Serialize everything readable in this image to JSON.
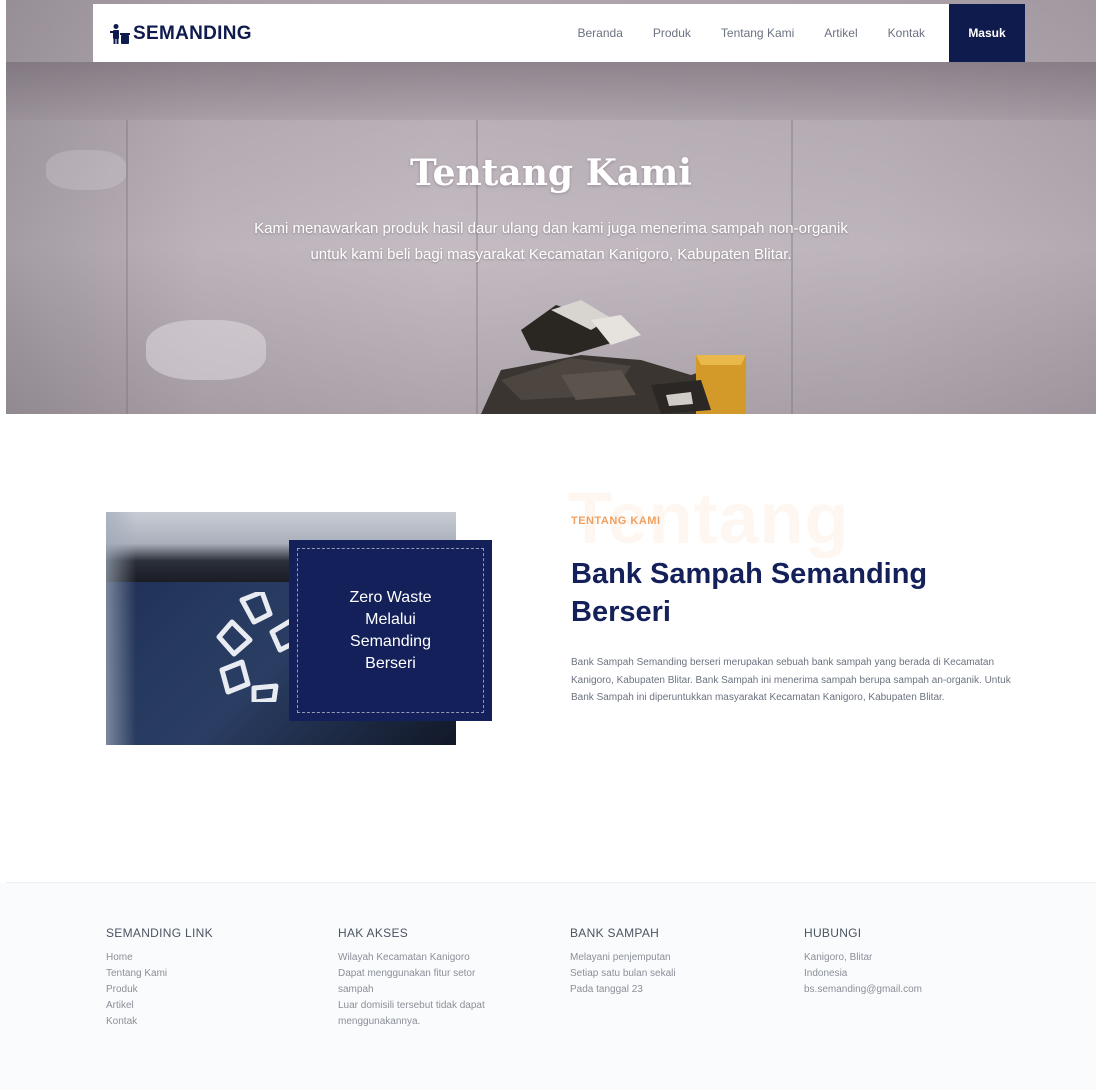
{
  "brand": {
    "name": "SEMANDING"
  },
  "nav": {
    "items": [
      "Beranda",
      "Produk",
      "Tentang Kami",
      "Artikel",
      "Kontak"
    ],
    "login_label": "Masuk"
  },
  "hero": {
    "title": "Tentang Kami",
    "subtitle_line1": "Kami menawarkan produk hasil daur ulang dan kami juga menerima sampah non-organik",
    "subtitle_line2": "untuk kami beli bagi masyarakat Kecamatan Kanigoro, Kabupaten Blitar."
  },
  "about": {
    "card_text": "Zero Waste Melalui Semanding Berseri",
    "ghost_word": "Tentang",
    "eyebrow": "TENTANG KAMI",
    "title": "Bank Sampah Semanding Berseri",
    "body": "Bank Sampah Semanding berseri merupakan sebuah bank sampah yang berada di Kecamatan Kanigoro, Kabupaten Blitar. Bank Sampah ini menerima sampah berupa sampah an-organik. Untuk Bank Sampah ini diperuntukkan masyarakat Kecamatan Kanigoro, Kabupaten Blitar."
  },
  "footer": {
    "columns": [
      {
        "heading": "SEMANDING LINK",
        "lines": [
          "Home",
          "Tentang Kami",
          "Produk",
          "Artikel",
          "Kontak"
        ]
      },
      {
        "heading": "HAK AKSES",
        "lines": [
          "Wilayah Kecamatan Kanigoro",
          "Dapat menggunakan fitur setor",
          "sampah",
          "Luar domisili tersebut tidak dapat",
          "menggunakannya."
        ]
      },
      {
        "heading": "BANK SAMPAH",
        "lines": [
          "Melayani penjemputan",
          "Setiap satu bulan sekali",
          "Pada tanggal 23"
        ]
      },
      {
        "heading": "HUBUNGI",
        "lines": [
          "Kanigoro, Blitar",
          "Indonesia",
          "bs.semanding@gmail.com"
        ]
      }
    ]
  },
  "colors": {
    "navy": "#13205a",
    "accent_orange": "#f0a060"
  }
}
